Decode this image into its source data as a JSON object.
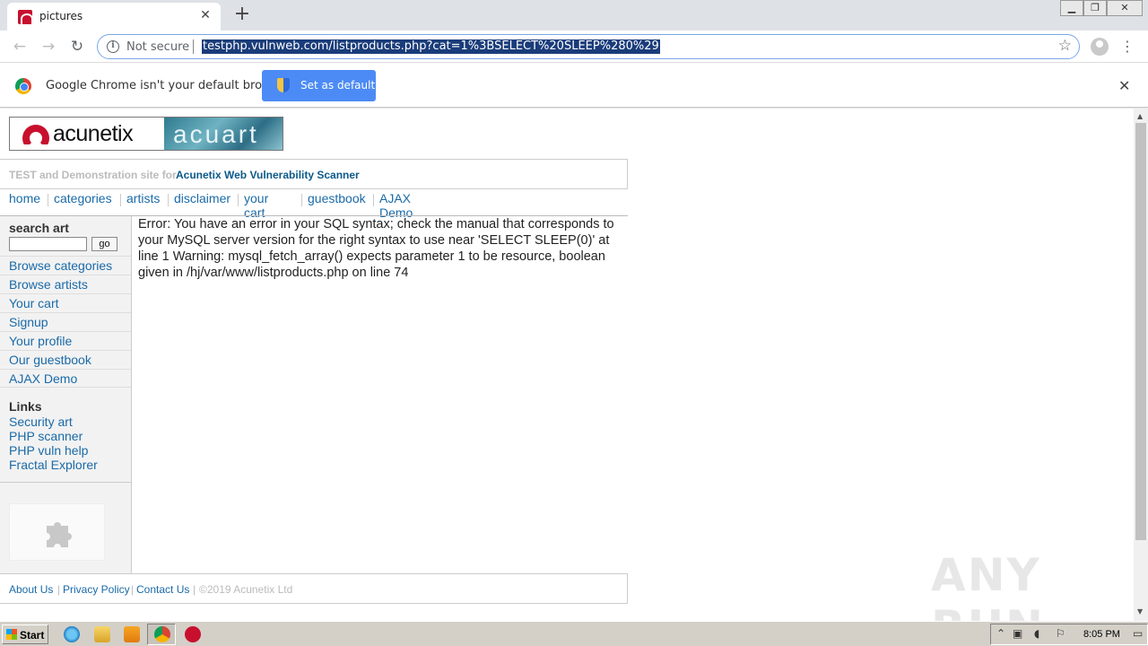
{
  "browser": {
    "tab_title": "pictures",
    "security_label": "Not secure",
    "url": "testphp.vulnweb.com/listproducts.php?cat=1%3BSELECT%20SLEEP%280%29"
  },
  "infobar": {
    "message": "Google Chrome isn't your default browser",
    "set_default_label": "Set as default"
  },
  "site": {
    "logo_brand": "acunetix",
    "logo_art": "acuart",
    "tagline_prefix": "TEST and Demonstration site for",
    "tagline_name": "Acunetix Web Vulnerability Scanner",
    "topnav": [
      "home",
      "categories",
      "artists",
      "disclaimer",
      "your cart",
      "guestbook",
      "AJAX Demo"
    ],
    "search_label": "search art",
    "search_value": "",
    "go_label": "go",
    "side_links": [
      "Browse categories",
      "Browse artists",
      "Your cart",
      "Signup",
      "Your profile",
      "Our guestbook",
      "AJAX Demo"
    ],
    "links_heading": "Links",
    "external_links": [
      "Security art",
      "PHP scanner",
      "PHP vuln help",
      "Fractal Explorer"
    ],
    "error_message": "Error: You have an error in your SQL syntax; check the manual that corresponds to your MySQL server version for the right syntax to use near 'SELECT SLEEP(0)' at line 1 Warning: mysql_fetch_array() expects parameter 1 to be resource, boolean given in /hj/var/www/listproducts.php on line 74",
    "footer": {
      "about": "About Us",
      "privacy": "Privacy Policy",
      "contact": "Contact Us",
      "copyright": "©2019 Acunetix Ltd",
      "separator": "|"
    }
  },
  "watermark": "ANY RUN",
  "taskbar": {
    "start_label": "Start",
    "clock": "8:05 PM"
  },
  "colors": {
    "link": "#1a6aa8",
    "brand_red": "#c8102e",
    "chrome_button": "#4c8bf5"
  }
}
